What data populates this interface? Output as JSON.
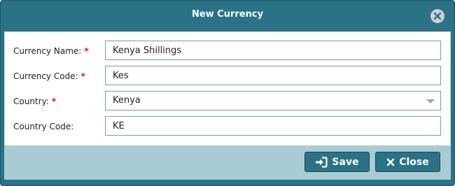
{
  "dialog": {
    "title": "New Currency",
    "close_icon": "close-circle-icon"
  },
  "form": {
    "currency_name": {
      "label": "Currency Name:",
      "required": "*",
      "value": "Kenya Shillings"
    },
    "currency_code": {
      "label": "Currency Code:",
      "required": "*",
      "value": "Kes"
    },
    "country": {
      "label": "Country:",
      "required": "*",
      "value": "Kenya"
    },
    "country_code": {
      "label": "Country Code:",
      "value": "KE"
    }
  },
  "footer": {
    "save_label": "Save",
    "save_icon": "sign-in-icon",
    "close_label": "Close",
    "close_icon": "x-icon"
  },
  "colors": {
    "primary": "#2a7286",
    "footer_bg": "#a8cbd4",
    "required": "#d9161c"
  }
}
